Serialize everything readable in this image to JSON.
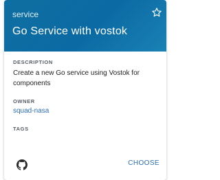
{
  "card": {
    "type": "service",
    "title": "Go Service with vostok",
    "description_label": "DESCRIPTION",
    "description": "Create a new Go service using Vostok for components",
    "owner_label": "OWNER",
    "owner": "squad-nasa",
    "tags_label": "TAGS",
    "choose_label": "CHOOSE",
    "icons": [
      "star-outline-icon",
      "github-icon"
    ],
    "colors": {
      "header": "#0b6aa3",
      "link": "#2a6db7"
    }
  }
}
